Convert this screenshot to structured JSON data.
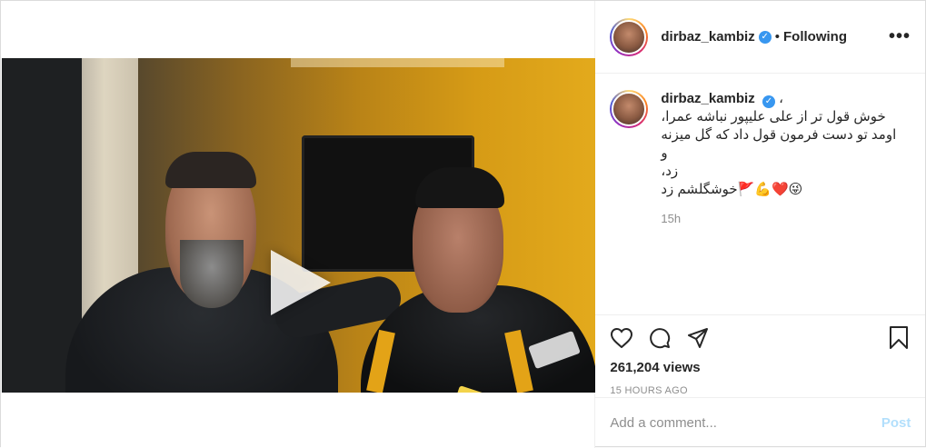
{
  "post": {
    "username": "dirbaz_kambiz",
    "follow_status": "Following",
    "more_icon": "more-horizontal-icon",
    "caption": {
      "username": "dirbaz_kambiz",
      "first_line_tail": "،",
      "lines": [
        "خوش قول تر از علی علیپور نباشه عمرا،",
        "اومد تو دست فرمون قول داد که گل میزنه",
        "و",
        "زد،",
        "😜❤️💪🚩خوشگلشم زد"
      ],
      "time": "15h"
    },
    "views": "261,204 views",
    "posted_ago": "15 HOURS AGO",
    "comment": {
      "placeholder": "Add a comment...",
      "post_label": "Post"
    },
    "colors": {
      "link_blue": "#3897f0",
      "post_disabled": "#b2dffc",
      "muted": "#8e8e8e"
    }
  }
}
